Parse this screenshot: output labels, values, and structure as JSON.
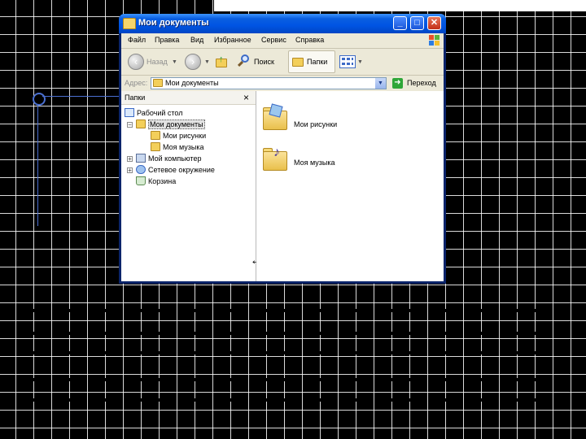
{
  "window": {
    "title": "Мои документы",
    "buttons": {
      "minimize": "_",
      "maximize": "□",
      "close": "✕"
    }
  },
  "menu": {
    "items": [
      {
        "label": "Файл"
      },
      {
        "label": "Правка"
      },
      {
        "label": "Вид"
      },
      {
        "label": "Избранное"
      },
      {
        "label": "Сервис"
      },
      {
        "label": "Справка"
      }
    ]
  },
  "toolbar": {
    "back_label": "Назад",
    "search_label": "Поиск",
    "folders_label": "Папки"
  },
  "address": {
    "label": "Адрес:",
    "value": "Мои документы",
    "go_label": "Переход"
  },
  "folders_pane": {
    "title": "Папки",
    "close_glyph": "×",
    "tree": [
      {
        "label": "Рабочий стол"
      },
      {
        "label": "Мои документы"
      },
      {
        "label": "Мои рисунки"
      },
      {
        "label": "Моя музыка"
      },
      {
        "label": "Мой компьютер"
      },
      {
        "label": "Сетевое окружение"
      },
      {
        "label": "Корзина"
      }
    ]
  },
  "files": [
    {
      "label": "Мои рисунки",
      "icon": "pictures-folder-icon"
    },
    {
      "label": "Моя музыка",
      "icon": "music-folder-icon"
    }
  ],
  "colors": {
    "titlebar": "#0054e3",
    "chrome": "#ece9d8",
    "folder": "#f3cf5a"
  }
}
